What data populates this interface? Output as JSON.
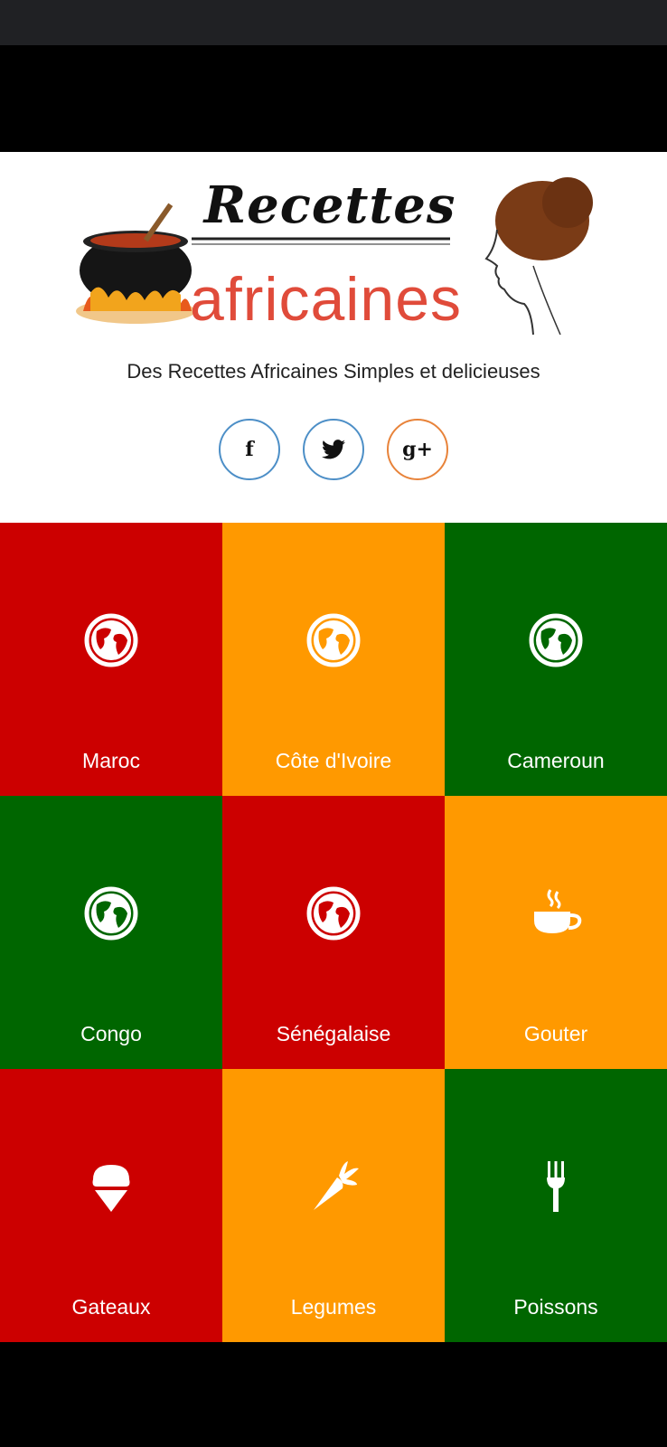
{
  "header": {
    "logo_title": "Recettes",
    "logo_sub": "africaines",
    "tagline": "Des Recettes Africaines Simples et delicieuses"
  },
  "social": [
    {
      "name": "facebook",
      "glyph": "f",
      "color": "#4d8fc7"
    },
    {
      "name": "twitter",
      "glyph": "🐦",
      "color": "#4d8fc7"
    },
    {
      "name": "google-plus",
      "glyph": "g+",
      "color": "#e8833a"
    }
  ],
  "colors": {
    "red": "#cc0000",
    "orange": "#ff9900",
    "green": "#006600"
  },
  "tiles": [
    {
      "label": "Maroc",
      "icon": "globe-icon",
      "color": "#cc0000"
    },
    {
      "label": "Côte d'Ivoire",
      "icon": "globe-icon",
      "color": "#ff9900"
    },
    {
      "label": "Cameroun",
      "icon": "globe-icon",
      "color": "#006600"
    },
    {
      "label": "Congo",
      "icon": "globe-icon",
      "color": "#006600"
    },
    {
      "label": "Sénégalaise",
      "icon": "globe-icon",
      "color": "#cc0000"
    },
    {
      "label": "Gouter",
      "icon": "coffee-cup-icon",
      "color": "#ff9900"
    },
    {
      "label": "Gateaux",
      "icon": "ice-cream-icon",
      "color": "#cc0000"
    },
    {
      "label": "Legumes",
      "icon": "carrot-icon",
      "color": "#ff9900"
    },
    {
      "label": "Poissons",
      "icon": "fork-icon",
      "color": "#006600"
    }
  ]
}
